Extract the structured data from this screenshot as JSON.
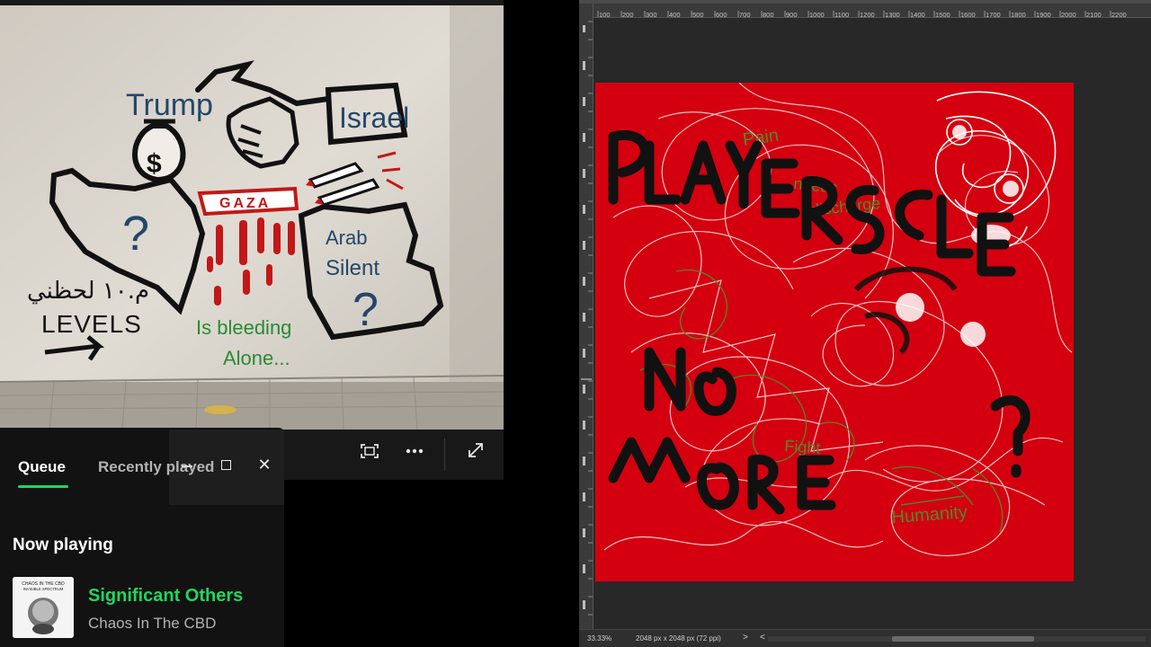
{
  "player": {
    "toolbar": {
      "fullscreen_icon": "fullscreen-icon",
      "more_icon": "more-options-icon",
      "expand_icon": "expand-icon"
    },
    "artwork": {
      "texts": {
        "trump": "Trump",
        "israel": "Israel",
        "gaza": "GAZA",
        "arab": "Arab",
        "silent": "Silent",
        "q1": "?",
        "q2": "?",
        "levels": "LEVELS",
        "arabic": "م.١٠ لحظني",
        "bleeding": "Is bleeding",
        "alone": "Alone...",
        "dollar": "$"
      }
    }
  },
  "queue_panel": {
    "tabs": [
      {
        "label": "Queue",
        "active": true
      },
      {
        "label": "Recently played",
        "active": false
      }
    ],
    "now_playing_label": "Now playing",
    "track": {
      "title": "Significant Others",
      "artist": "Chaos In The CBD",
      "album_art_text": "CHAOS IN THE CBD\nINVISIBLE SPECTRUM"
    },
    "colors": {
      "accent": "#1ed760",
      "panel_bg": "#121212"
    }
  },
  "photoshop": {
    "ruler_labels": [
      "100",
      "200",
      "300",
      "400",
      "500",
      "600",
      "700",
      "800",
      "900",
      "1000",
      "1100",
      "1200",
      "1300",
      "1400",
      "1500",
      "1600",
      "1700",
      "1800",
      "1900",
      "2000",
      "2100",
      "2200"
    ],
    "status": {
      "zoom": "33.33%",
      "doc_size": "2048 px x 2048 px (72 ppi)",
      "arrow": ">",
      "scroll_left": "<"
    },
    "canvas": {
      "background": "#d4000f",
      "text_strokes": [
        "PLAYERS",
        "CLE",
        "NO",
        "MORE"
      ]
    }
  }
}
